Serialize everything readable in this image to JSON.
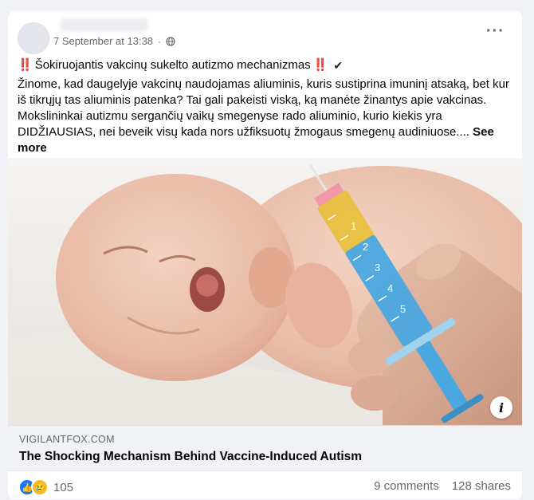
{
  "post": {
    "timestamp": "7 September at 13:38",
    "separator": "·",
    "privacy_icon": "globe-icon",
    "more_icon": "ellipsis-icon",
    "headline_bang": "‼️",
    "headline": "Šokiruojantis vakcinų sukelto autizmo mechanizmas",
    "headline_end": "‼️",
    "headline_check": "✔",
    "body": "Žinome, kad daugelyje vakcinų naudojamas aliuminis, kuris sustiprina imuninį atsaką, bet kur iš tikrųjų tas aliuminis patenka? Tai gali pakeisti viską, ką manėte žinantys apie vakcinas. Mokslininkai autizmu sergančių vaikų smegenyse rado aliuminio, kurio kiekis yra DIDŽIAUSIAS, nei beveik visų kada nors užfiksuotų žmogaus smegenų audiniuose.... ",
    "see_more": "See more"
  },
  "image": {
    "description_icon": "info-icon",
    "info_glyph": "i",
    "syringe_numbers": [
      "1",
      "2",
      "3",
      "4",
      "5"
    ]
  },
  "link": {
    "domain": "VIGILANTFOX.COM",
    "title": "The Shocking Mechanism Behind Vaccine-Induced Autism"
  },
  "footer": {
    "reaction_count": "105",
    "comments": "9 comments",
    "shares": "128 shares"
  },
  "colors": {
    "facebook_blue": "#1877f2",
    "syringe_blue": "#4aa8e0",
    "syringe_yellow": "#e8c040"
  }
}
